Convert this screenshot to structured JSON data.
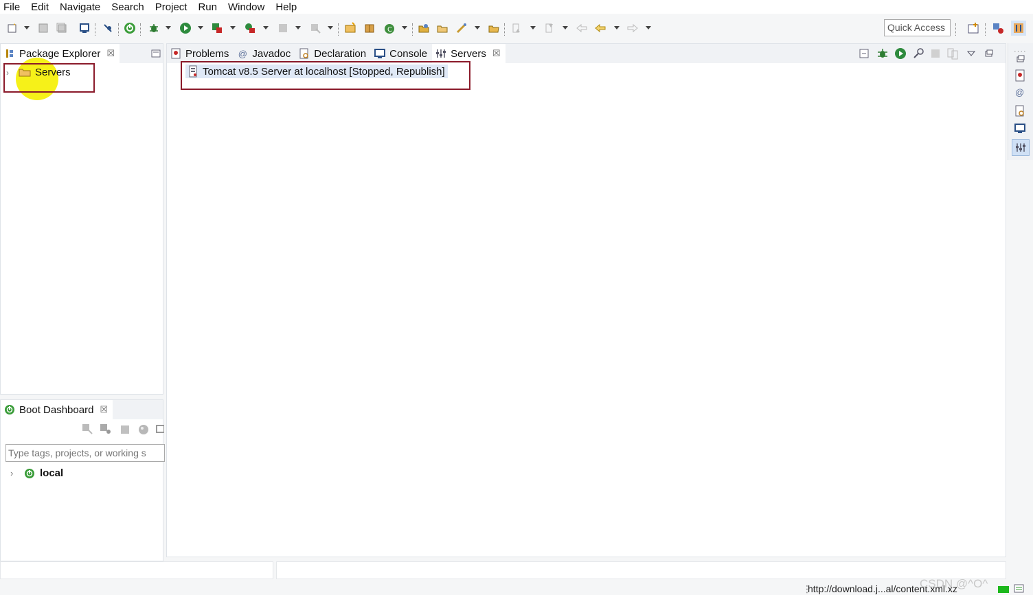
{
  "menu": [
    "File",
    "Edit",
    "Navigate",
    "Search",
    "Project",
    "Run",
    "Window",
    "Help"
  ],
  "toolbar": {
    "quick_access": "Quick Access"
  },
  "package_explorer": {
    "tab_label": "Package Explorer",
    "tree": [
      {
        "label": "Servers",
        "expanded": false
      }
    ]
  },
  "boot_dashboard": {
    "tab_label": "Boot Dashboard",
    "filter_placeholder": "Type tags, projects, or working s",
    "tree": [
      {
        "label": "local",
        "expanded": false
      }
    ]
  },
  "editor_tabs": [
    {
      "label": "Problems",
      "icon": "problems-icon",
      "active": false
    },
    {
      "label": "Javadoc",
      "icon": "javadoc-icon",
      "active": false
    },
    {
      "label": "Declaration",
      "icon": "declaration-icon",
      "active": false
    },
    {
      "label": "Console",
      "icon": "console-icon",
      "active": false
    },
    {
      "label": "Servers",
      "icon": "servers-icon",
      "active": true
    }
  ],
  "servers": [
    {
      "label": "Tomcat v8.5 Server at localhost  [Stopped, Republish]"
    }
  ],
  "status": {
    "url": "http://download.j...al/content.xml.xz",
    "watermark": "CSDN @^O^"
  },
  "colors": {
    "highlight_box": "#8b1a2a",
    "spring_green": "#3b9d3a",
    "selection": "#dfe8f6",
    "cursor_highlight": "#f5f000"
  }
}
